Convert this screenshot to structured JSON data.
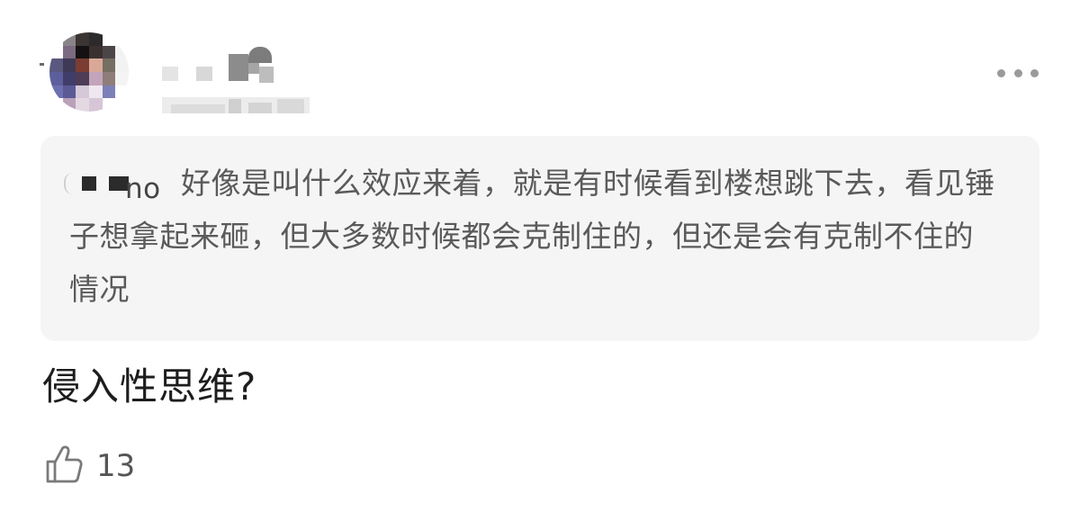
{
  "post": {
    "quote": {
      "author_visible_suffix": "no",
      "text": "好像是叫什么效应来着，就是有时候看到楼想跳下去，看见锤子想拿起来砸，但大多数时候都会克制住的，但还是会有克制不住的情况"
    },
    "comment": "侵入性思维?",
    "likes": "13"
  },
  "icons": {
    "more": "more-horizontal-icon",
    "like": "thumbs-up-icon"
  },
  "colors": {
    "quote_background": "#f5f5f5",
    "quote_text": "#5a5a5a",
    "comment_text": "#1d1d1d",
    "icon_gray": "#9a9a9a"
  }
}
